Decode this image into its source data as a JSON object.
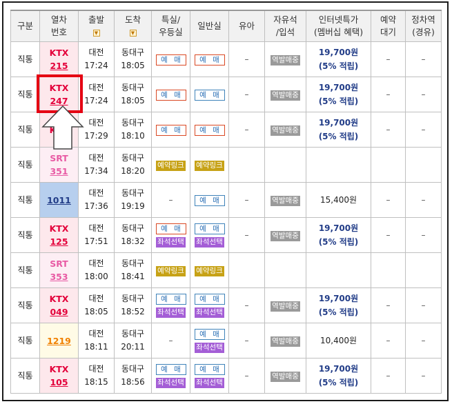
{
  "headers": [
    {
      "name": "header-type",
      "label": "구분"
    },
    {
      "name": "header-train-no",
      "label": "열차\n번호"
    },
    {
      "name": "header-depart",
      "label": "출발"
    },
    {
      "name": "header-arrive",
      "label": "도착"
    },
    {
      "name": "header-special",
      "label": "특실/\n우등실"
    },
    {
      "name": "header-general",
      "label": "일반실"
    },
    {
      "name": "header-infant",
      "label": "유아"
    },
    {
      "name": "header-free",
      "label": "자유석\n/입석"
    },
    {
      "name": "header-internet",
      "label": "인터넷특가\n(멤버십 혜택)"
    },
    {
      "name": "header-waitlist",
      "label": "예약\n대기"
    },
    {
      "name": "header-stops",
      "label": "정차역\n(경유)"
    }
  ],
  "sort_icon": "sort-down-icon",
  "rows": [
    {
      "type": "직통",
      "brand": "KTX",
      "no": "215",
      "style": "ktx",
      "dep_st": "대전",
      "dep_t": "17:24",
      "arr_st": "동대구",
      "arr_t": "18:05",
      "special": [
        "예 매"
      ],
      "special_style": "red",
      "general": [
        "예 매"
      ],
      "general_style": "red",
      "infant": "–",
      "free": "역발매중",
      "price1": "19,700원",
      "price2": "(5% 적립)",
      "wait": "–",
      "stops": "–"
    },
    {
      "type": "직통",
      "brand": "KTX",
      "no": "247",
      "style": "ktx",
      "dep_st": "대전",
      "dep_t": "17:24",
      "arr_st": "동대구",
      "arr_t": "18:05",
      "special": [
        "예 매"
      ],
      "special_style": "red",
      "general": [
        "예 매"
      ],
      "general_style": "blue",
      "infant": "–",
      "free": "역발매중",
      "price1": "19,700원",
      "price2": "(5% 적립)",
      "wait": "–",
      "stops": "–"
    },
    {
      "type": "직통",
      "brand": "KTX",
      "no": "",
      "style": "ktx",
      "dep_st": "대전",
      "dep_t": "17:29",
      "arr_st": "동대구",
      "arr_t": "18:10",
      "special": [
        "예 매"
      ],
      "special_style": "red",
      "general": [
        "예 매"
      ],
      "general_style": "red",
      "infant": "–",
      "free": "역발매중",
      "price1": "19,700원",
      "price2": "(5% 적립)",
      "wait": "–",
      "stops": "–"
    },
    {
      "type": "직통",
      "brand": "SRT",
      "no": "351",
      "style": "srt",
      "dep_st": "대전",
      "dep_t": "17:34",
      "arr_st": "동대구",
      "arr_t": "18:20",
      "special": [
        "예약링크"
      ],
      "special_style": "link",
      "general": [
        "예약링크"
      ],
      "general_style": "link",
      "infant": "",
      "free": "",
      "price1": "",
      "price2": "",
      "wait": "",
      "stops": ""
    },
    {
      "type": "직통",
      "brand": "",
      "no": "1011",
      "style": "itx",
      "dep_st": "대전",
      "dep_t": "17:36",
      "arr_st": "동대구",
      "arr_t": "19:19",
      "special": [],
      "special_style": "none",
      "special_dash": "–",
      "general": [
        "예 매"
      ],
      "general_style": "blue",
      "infant": "–",
      "free": "역발매중",
      "price1": "15,400원",
      "price2": "",
      "wait": "–",
      "stops": "–"
    },
    {
      "type": "직통",
      "brand": "KTX",
      "no": "125",
      "style": "ktx",
      "dep_st": "대전",
      "dep_t": "17:51",
      "arr_st": "동대구",
      "arr_t": "18:32",
      "special": [
        "예 매",
        "좌석선택"
      ],
      "special_style": "red",
      "general": [
        "예 매",
        "좌석선택"
      ],
      "general_style": "blue",
      "infant": "–",
      "free": "역발매중",
      "price1": "19,700원",
      "price2": "(5% 적립)",
      "wait": "–",
      "stops": "–"
    },
    {
      "type": "직통",
      "brand": "SRT",
      "no": "353",
      "style": "srt",
      "dep_st": "대전",
      "dep_t": "18:00",
      "arr_st": "동대구",
      "arr_t": "18:41",
      "special": [
        "예약링크"
      ],
      "special_style": "link",
      "general": [
        "예약링크"
      ],
      "general_style": "link",
      "infant": "",
      "free": "",
      "price1": "",
      "price2": "",
      "wait": "",
      "stops": ""
    },
    {
      "type": "직통",
      "brand": "KTX",
      "no": "049",
      "style": "ktx",
      "dep_st": "대전",
      "dep_t": "18:05",
      "arr_st": "동대구",
      "arr_t": "18:52",
      "special": [
        "예 매",
        "좌석선택"
      ],
      "special_style": "blue",
      "general": [
        "예 매",
        "좌석선택"
      ],
      "general_style": "blue",
      "infant": "–",
      "free": "역발매중",
      "price1": "19,700원",
      "price2": "(5% 적립)",
      "wait": "–",
      "stops": "–"
    },
    {
      "type": "직통",
      "brand": "",
      "no": "1219",
      "style": "mugung",
      "dep_st": "대전",
      "dep_t": "18:11",
      "arr_st": "동대구",
      "arr_t": "20:11",
      "special": [],
      "special_style": "none",
      "special_dash": "–",
      "general": [
        "예 매",
        "좌석선택"
      ],
      "general_style": "blue",
      "infant": "–",
      "free": "역발매중",
      "price1": "10,400원",
      "price2": "",
      "wait": "–",
      "stops": "–"
    },
    {
      "type": "직통",
      "brand": "KTX",
      "no": "105",
      "style": "ktx",
      "dep_st": "대전",
      "dep_t": "18:15",
      "arr_st": "동대구",
      "arr_t": "18:56",
      "special": [
        "예 매",
        "좌석선택"
      ],
      "special_style": "blue",
      "general": [
        "예 매",
        "좌석선택"
      ],
      "general_style": "blue",
      "infant": "–",
      "free": "역발매중",
      "price1": "19,700원",
      "price2": "(5% 적립)",
      "wait": "–",
      "stops": "–"
    }
  ],
  "highlight_color": "#e50012",
  "annotation_icon": "up-arrow-icon"
}
